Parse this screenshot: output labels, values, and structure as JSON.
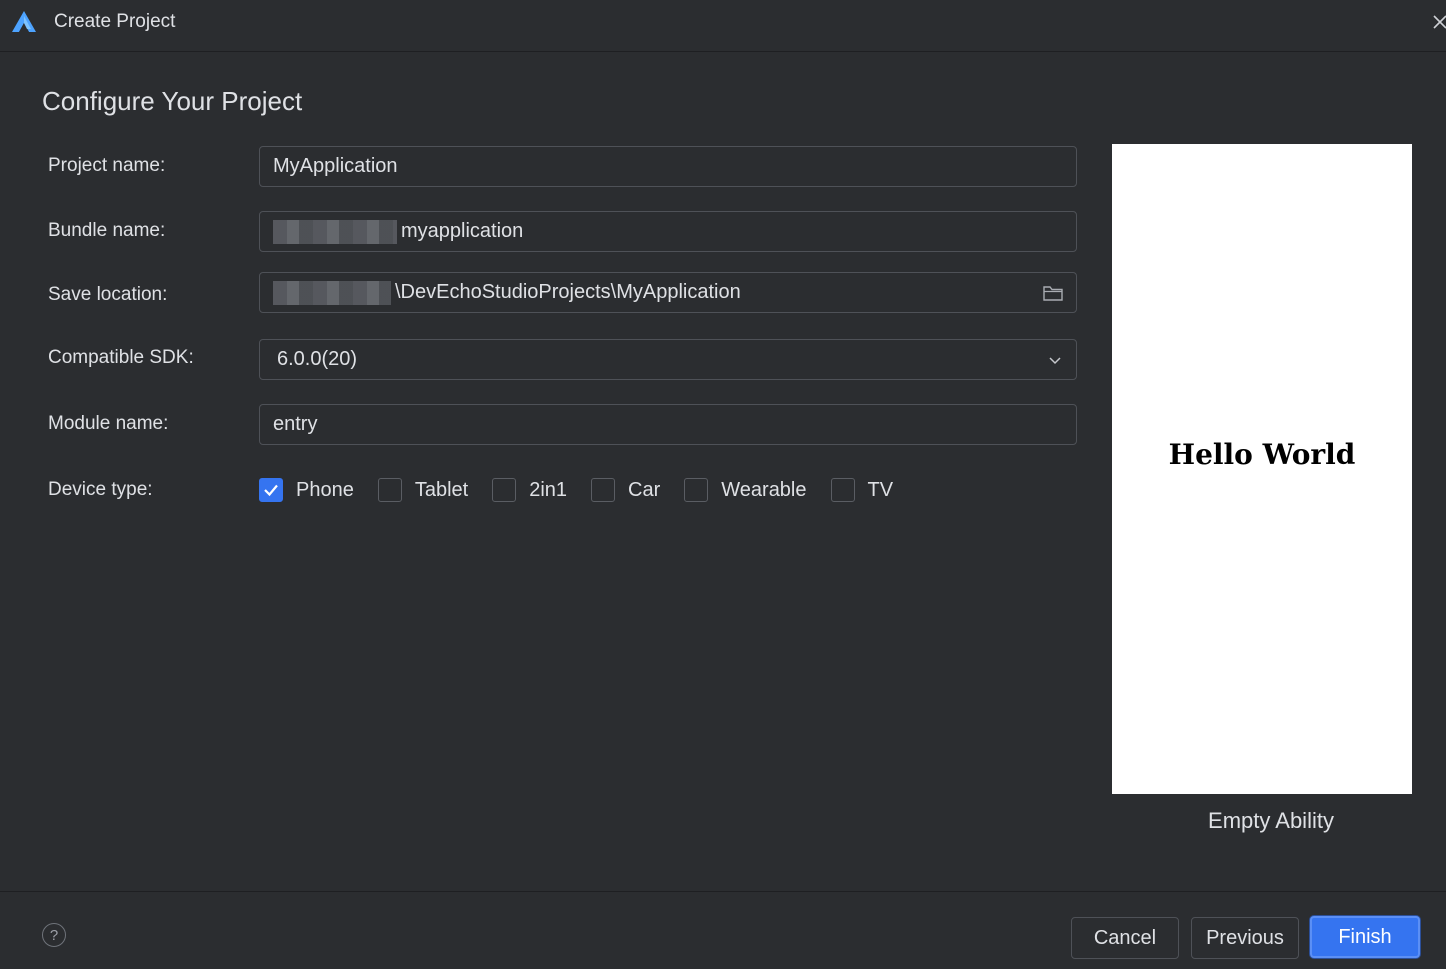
{
  "window": {
    "title": "Create Project",
    "logo_icon": "devecho-logo-icon"
  },
  "page": {
    "heading": "Configure Your Project"
  },
  "form": {
    "project_name": {
      "label": "Project name:",
      "value": "MyApplication"
    },
    "bundle_name": {
      "label": "Bundle name:",
      "value": "myapplication"
    },
    "save_location": {
      "label": "Save location:",
      "value": "\\DevEchoStudioProjects\\MyApplication"
    },
    "compatible_sdk": {
      "label": "Compatible SDK:",
      "value": "6.0.0(20)"
    },
    "module_name": {
      "label": "Module name:",
      "value": "entry"
    },
    "device_type": {
      "label": "Device type:",
      "options": [
        {
          "label": "Phone",
          "checked": true
        },
        {
          "label": "Tablet",
          "checked": false
        },
        {
          "label": "2in1",
          "checked": false
        },
        {
          "label": "Car",
          "checked": false
        },
        {
          "label": "Wearable",
          "checked": false
        },
        {
          "label": "TV",
          "checked": false
        }
      ]
    }
  },
  "preview": {
    "text": "Hello World",
    "caption": "Empty Ability"
  },
  "footer": {
    "help": "?",
    "cancel": "Cancel",
    "previous": "Previous",
    "finish": "Finish"
  },
  "colors": {
    "background": "#2b2d30",
    "accent": "#3574f0",
    "border": "#4e5157",
    "text": "#dfe1e5"
  }
}
